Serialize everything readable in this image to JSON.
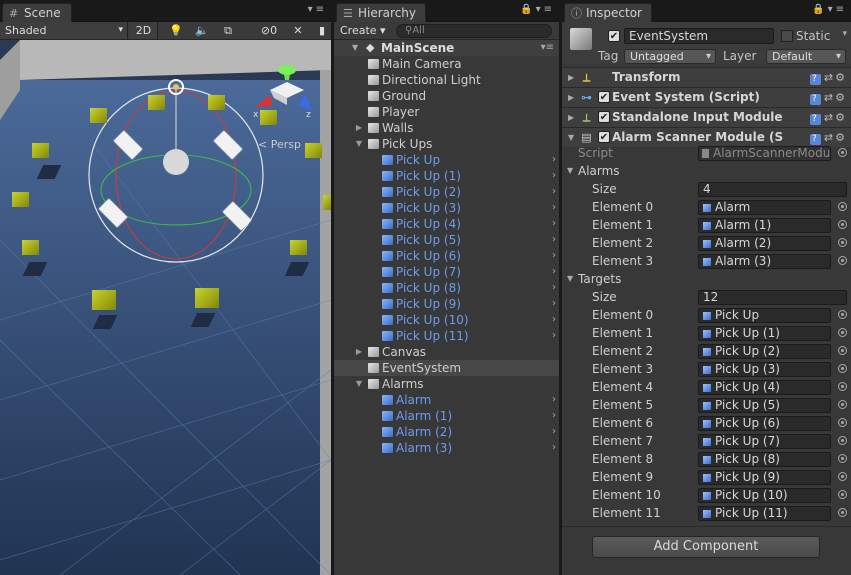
{
  "scene": {
    "tab_label": "Scene",
    "shading_mode": "Shaded",
    "mode_2d": "2D",
    "gizmo_count": "0",
    "persp_label": "< Persp",
    "axis_x": "x",
    "axis_z": "z"
  },
  "hierarchy": {
    "tab_label": "Hierarchy",
    "create_label": "Create ▾",
    "search_placeholder": "All",
    "scene_name": "MainScene",
    "rows": [
      {
        "label": "Main Camera"
      },
      {
        "label": "Directional Light"
      },
      {
        "label": "Ground"
      },
      {
        "label": "Player"
      },
      {
        "label": "Walls"
      },
      {
        "label": "Pick Ups"
      },
      {
        "label": "Pick Up"
      },
      {
        "label": "Pick Up (1)"
      },
      {
        "label": "Pick Up (2)"
      },
      {
        "label": "Pick Up (3)"
      },
      {
        "label": "Pick Up (4)"
      },
      {
        "label": "Pick Up (5)"
      },
      {
        "label": "Pick Up (6)"
      },
      {
        "label": "Pick Up (7)"
      },
      {
        "label": "Pick Up (8)"
      },
      {
        "label": "Pick Up (9)"
      },
      {
        "label": "Pick Up (10)"
      },
      {
        "label": "Pick Up (11)"
      },
      {
        "label": "Canvas"
      },
      {
        "label": "EventSystem"
      },
      {
        "label": "Alarms"
      },
      {
        "label": "Alarm"
      },
      {
        "label": "Alarm (1)"
      },
      {
        "label": "Alarm (2)"
      },
      {
        "label": "Alarm (3)"
      }
    ]
  },
  "inspector": {
    "tab_label": "Inspector",
    "object_name": "EventSystem",
    "static_label": "Static",
    "tag_label": "Tag",
    "tag_value": "Untagged",
    "layer_label": "Layer",
    "layer_value": "Default",
    "components": [
      {
        "name": "Transform"
      },
      {
        "name": "Event System (Script)"
      },
      {
        "name": "Standalone Input Module"
      },
      {
        "name": "Alarm Scanner Module (S"
      }
    ],
    "script_label": "Script",
    "script_value": "AlarmScannerModul",
    "alarms_label": "Alarms",
    "alarms_size_label": "Size",
    "alarms_size": "4",
    "alarms": [
      {
        "label": "Element 0",
        "value": "Alarm"
      },
      {
        "label": "Element 1",
        "value": "Alarm (1)"
      },
      {
        "label": "Element 2",
        "value": "Alarm (2)"
      },
      {
        "label": "Element 3",
        "value": "Alarm (3)"
      }
    ],
    "targets_label": "Targets",
    "targets_size_label": "Size",
    "targets_size": "12",
    "targets": [
      {
        "label": "Element 0",
        "value": "Pick Up"
      },
      {
        "label": "Element 1",
        "value": "Pick Up (1)"
      },
      {
        "label": "Element 2",
        "value": "Pick Up (2)"
      },
      {
        "label": "Element 3",
        "value": "Pick Up (3)"
      },
      {
        "label": "Element 4",
        "value": "Pick Up (4)"
      },
      {
        "label": "Element 5",
        "value": "Pick Up (5)"
      },
      {
        "label": "Element 6",
        "value": "Pick Up (6)"
      },
      {
        "label": "Element 7",
        "value": "Pick Up (7)"
      },
      {
        "label": "Element 8",
        "value": "Pick Up (8)"
      },
      {
        "label": "Element 9",
        "value": "Pick Up (9)"
      },
      {
        "label": "Element 10",
        "value": "Pick Up (10)"
      },
      {
        "label": "Element 11",
        "value": "Pick Up (11)"
      }
    ],
    "add_component_label": "Add Component"
  }
}
